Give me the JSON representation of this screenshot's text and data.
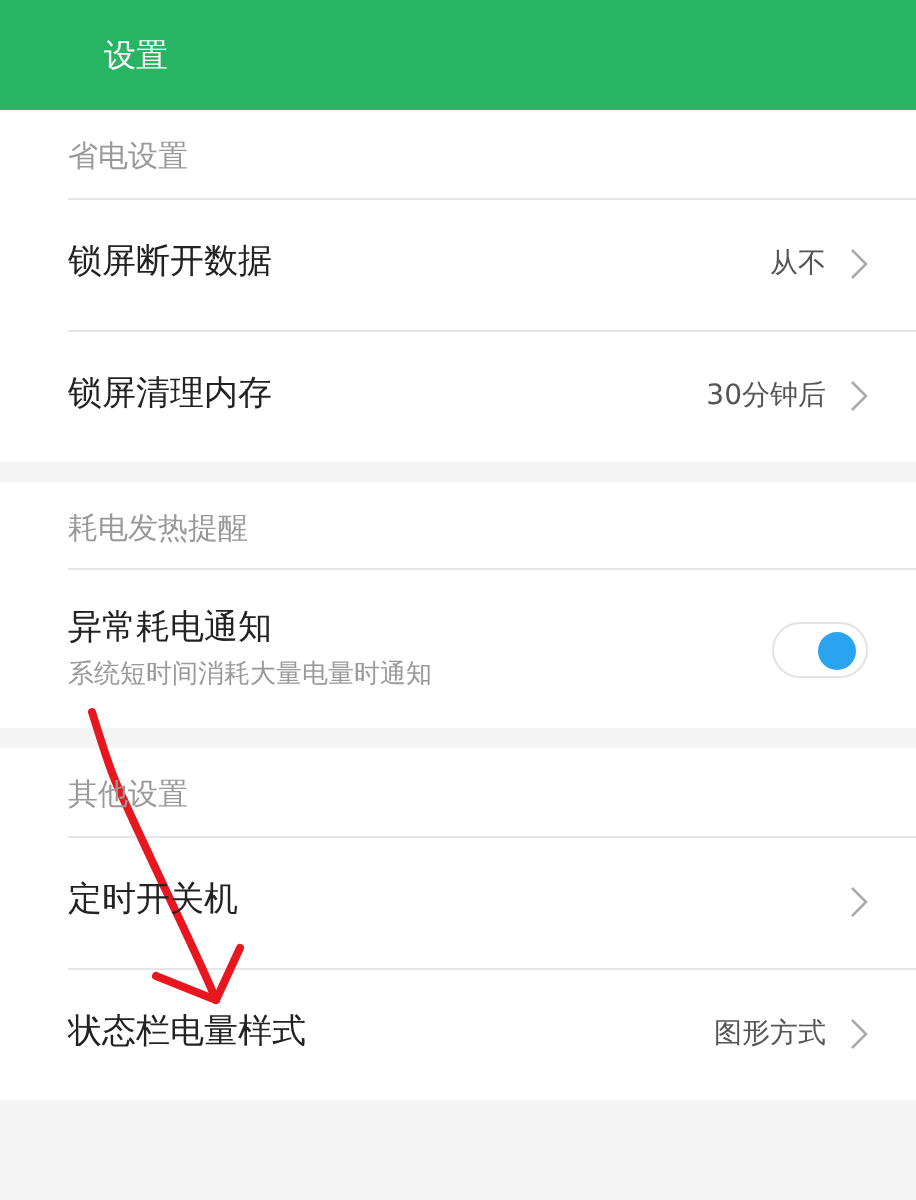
{
  "header": {
    "title": "设置"
  },
  "sections": [
    {
      "title": "省电设置",
      "items": [
        {
          "kind": "link",
          "label": "锁屏断开数据",
          "value": "从不"
        },
        {
          "kind": "link",
          "label": "锁屏清理内存",
          "value": "30分钟后"
        }
      ]
    },
    {
      "title": "耗电发热提醒",
      "items": [
        {
          "kind": "toggle",
          "label": "异常耗电通知",
          "subtitle": "系统短时间消耗大量电量时通知",
          "on": true
        }
      ]
    },
    {
      "title": "其他设置",
      "items": [
        {
          "kind": "link",
          "label": "定时开关机"
        },
        {
          "kind": "link",
          "label": "状态栏电量样式",
          "value": "图形方式"
        }
      ]
    }
  ],
  "annotation": {
    "kind": "arrow"
  }
}
